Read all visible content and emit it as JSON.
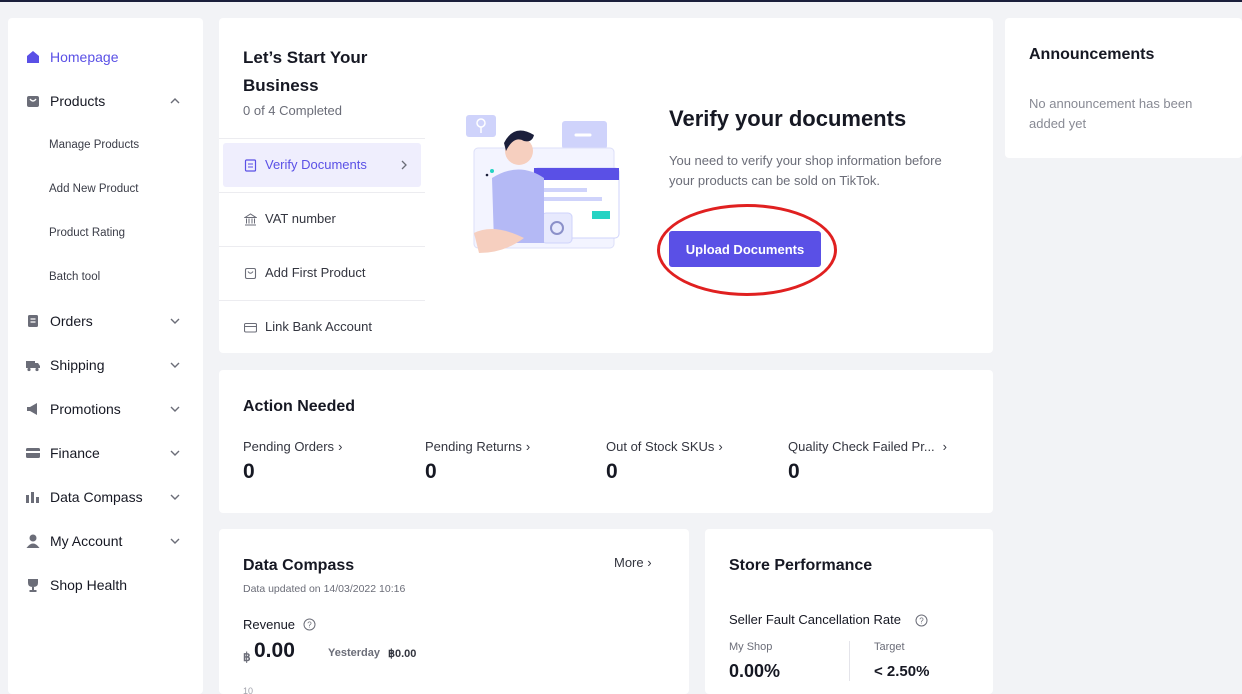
{
  "sidebar": {
    "items": [
      {
        "label": "Homepage",
        "icon": "home-icon",
        "active": true
      },
      {
        "label": "Products",
        "icon": "bag-icon",
        "expanded": true
      },
      {
        "label": "Orders",
        "icon": "document-icon"
      },
      {
        "label": "Shipping",
        "icon": "truck-icon"
      },
      {
        "label": "Promotions",
        "icon": "megaphone-icon"
      },
      {
        "label": "Finance",
        "icon": "card-icon"
      },
      {
        "label": "Data Compass",
        "icon": "bar-chart-icon"
      },
      {
        "label": "My Account",
        "icon": "user-icon"
      },
      {
        "label": "Shop Health",
        "icon": "trophy-icon"
      }
    ],
    "product_sub": [
      "Manage Products",
      "Add New Product",
      "Product Rating",
      "Batch tool"
    ]
  },
  "start": {
    "title": "Let’s Start Your Business",
    "progress": "0 of 4 Completed",
    "steps": [
      {
        "label": "Verify Documents",
        "icon": "document-icon"
      },
      {
        "label": "VAT number",
        "icon": "bank-icon"
      },
      {
        "label": "Add First Product",
        "icon": "bag-icon"
      },
      {
        "label": "Link Bank Account",
        "icon": "card-icon"
      }
    ],
    "verify_title": "Verify your documents",
    "verify_desc": "You need to verify your shop information before your products can be sold on TikTok.",
    "upload_label": "Upload Documents"
  },
  "announcements": {
    "title": "Announcements",
    "text": "No announcement has been added yet"
  },
  "action": {
    "title": "Action Needed",
    "metrics": [
      {
        "label": "Pending Orders",
        "value": "0"
      },
      {
        "label": "Pending Returns",
        "value": "0"
      },
      {
        "label": "Out of Stock SKUs",
        "value": "0"
      },
      {
        "label": "Quality Check Failed Pr...",
        "value": "0"
      }
    ]
  },
  "data_compass": {
    "title": "Data Compass",
    "updated": "Data updated on 14/03/2022 10:16",
    "more": "More",
    "revenue_label": "Revenue",
    "currency": "฿",
    "revenue_value": "0.00",
    "yesterday_label": "Yesterday",
    "yesterday_value": "฿0.00",
    "axis_top": "10"
  },
  "store_performance": {
    "title": "Store Performance",
    "metric_label": "Seller Fault Cancellation Rate",
    "my_shop_label": "My Shop",
    "my_shop_value": "0.00%",
    "target_label": "Target",
    "target_value": "< 2.50%"
  },
  "colors": {
    "accent": "#5a50e6",
    "highlight": "#e02020"
  }
}
